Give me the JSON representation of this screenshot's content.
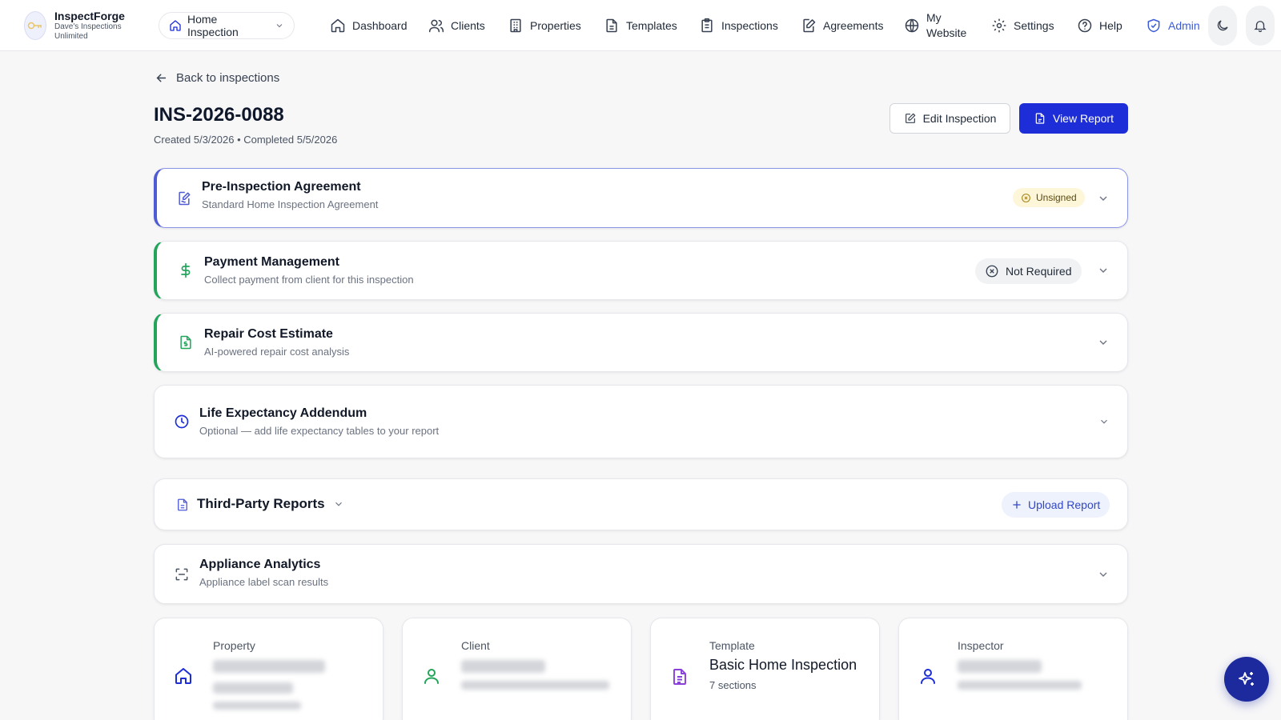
{
  "brand": {
    "name": "InspectForge",
    "subtitle": "Dave's Inspections Unlimited"
  },
  "workspace_selector": {
    "label": "Home Inspection"
  },
  "nav": [
    {
      "id": "dashboard",
      "label": "Dashboard",
      "icon": "home-icon"
    },
    {
      "id": "clients",
      "label": "Clients",
      "icon": "users-icon"
    },
    {
      "id": "properties",
      "label": "Properties",
      "icon": "building-icon"
    },
    {
      "id": "templates",
      "label": "Templates",
      "icon": "file-text-icon"
    },
    {
      "id": "inspections",
      "label": "Inspections",
      "icon": "clipboard-icon"
    },
    {
      "id": "agreements",
      "label": "Agreements",
      "icon": "edit-doc-icon"
    },
    {
      "id": "website",
      "label_line1": "My",
      "label_line2": "Website",
      "icon": "globe-icon"
    },
    {
      "id": "settings",
      "label": "Settings",
      "icon": "gear-icon"
    },
    {
      "id": "help",
      "label": "Help",
      "icon": "help-circle-icon"
    },
    {
      "id": "admin",
      "label": "Admin",
      "icon": "shield-check-icon"
    }
  ],
  "back_link": "Back to inspections",
  "inspection": {
    "id": "INS-2026-0088",
    "meta": "Created 5/3/2026 • Completed 5/5/2026"
  },
  "actions": {
    "edit": "Edit Inspection",
    "view_report": "View Report"
  },
  "cards": {
    "agreement": {
      "title": "Pre-Inspection Agreement",
      "subtitle": "Standard Home Inspection Agreement",
      "status": "Unsigned"
    },
    "payment": {
      "title": "Payment Management",
      "subtitle": "Collect payment from client for this inspection",
      "status": "Not Required"
    },
    "repair": {
      "title": "Repair Cost Estimate",
      "subtitle": "AI-powered repair cost analysis"
    },
    "life": {
      "title": "Life Expectancy Addendum",
      "subtitle": "Optional — add life expectancy tables to your report"
    },
    "third_party": {
      "title": "Third-Party Reports",
      "upload_label": "Upload Report"
    },
    "appliance": {
      "title": "Appliance Analytics",
      "subtitle": "Appliance label scan results"
    }
  },
  "info_cards": {
    "property": {
      "label": "Property"
    },
    "client": {
      "label": "Client"
    },
    "template": {
      "label": "Template",
      "value": "Basic Home Inspection",
      "sub": "7 sections"
    },
    "inspector": {
      "label": "Inspector"
    }
  },
  "colors": {
    "primary": "#1d2ed8",
    "admin": "#3b5bdb",
    "agreement_border": "#4f5bd5",
    "success": "#22a55a",
    "unsigned_badge_bg": "#fdf6d8",
    "fab": "#1d2a9e",
    "template_icon": "#8b3fd9"
  }
}
